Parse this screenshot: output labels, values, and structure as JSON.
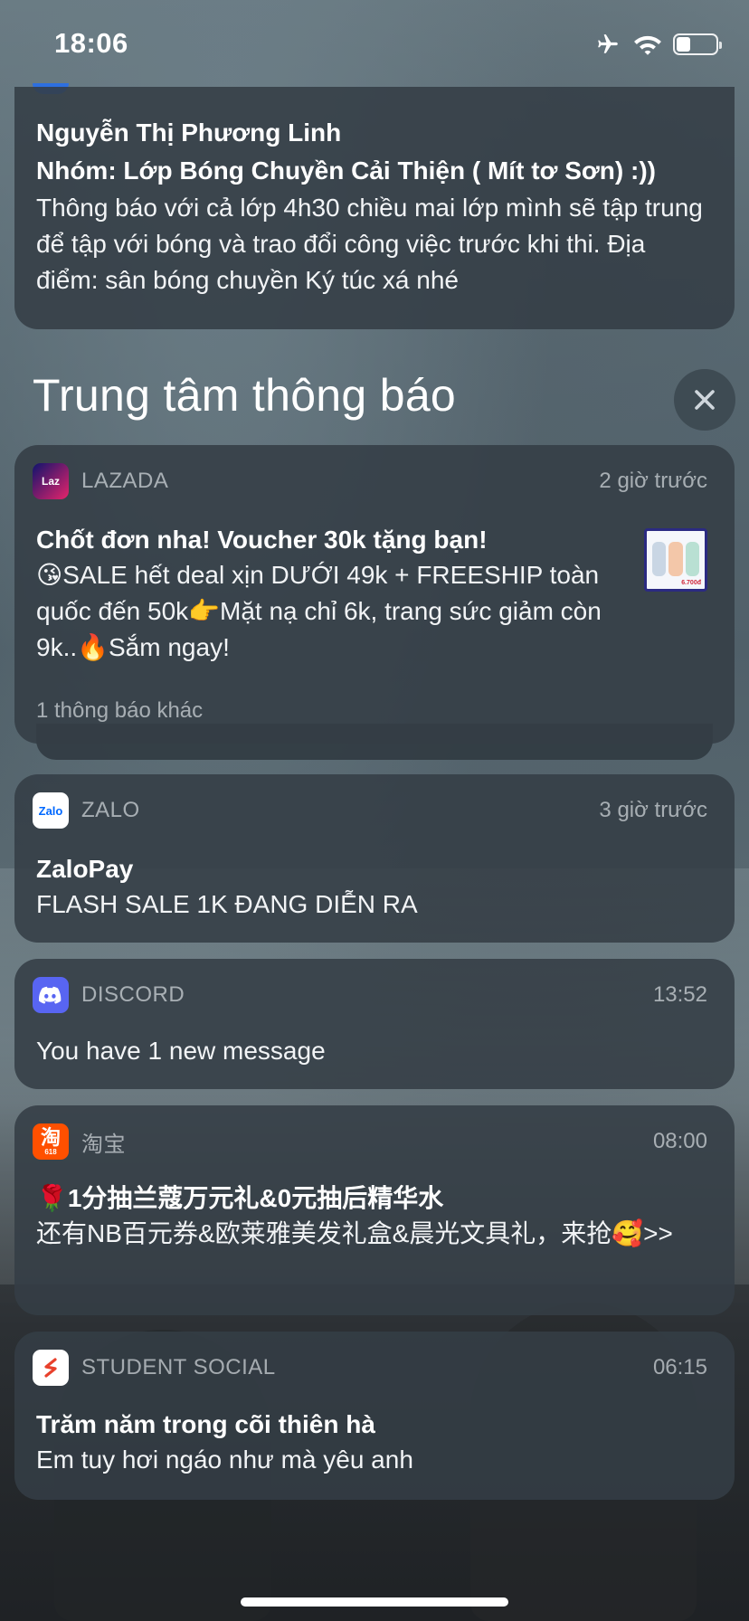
{
  "status_bar": {
    "time": "18:06",
    "icons": [
      "airplane-icon",
      "wifi-icon",
      "battery-icon"
    ],
    "battery_level": 0.35
  },
  "pinned_notification": {
    "sender": "Nguyễn Thị Phương Linh",
    "group": "Nhóm: Lớp Bóng Chuyền Cải Thiện ( Mít tơ Sơn) :))",
    "message": "Thông báo với cả lớp 4h30 chiều mai lớp mình sẽ tập trung để tập với bóng và trao đổi công việc trước khi thi. Địa điểm: sân bóng chuyền Ký túc xá nhé"
  },
  "notification_center": {
    "title": "Trung tâm thông báo"
  },
  "notifications": [
    {
      "app": "LAZADA",
      "icon": "lazada-icon",
      "time": "2 giờ trước",
      "title": "Chốt đơn nha! Voucher 30k tặng bạn!",
      "message": "😘SALE hết deal xịn DƯỚI 49k + FREESHIP toàn quốc đến 50k👉Mặt nạ chỉ 6k, trang sức giảm còn 9k..🔥Sắm ngay!",
      "more": "1 thông báo khác",
      "thumb_price": "6.700đ"
    },
    {
      "app": "ZALO",
      "icon": "zalo-icon",
      "time": "3 giờ trước",
      "title": "ZaloPay",
      "message": "FLASH SALE 1K ĐANG DIỄN RA"
    },
    {
      "app": "DISCORD",
      "icon": "discord-icon",
      "time": "13:52",
      "message": "You have 1 new message"
    },
    {
      "app": "淘宝",
      "icon": "taobao-icon",
      "time": "08:00",
      "title": "🌹1分抽兰蔻万元礼&0元抽后精华水",
      "message": "还有NB百元券&欧莱雅美发礼盒&晨光文具礼，来抢🥰>>"
    },
    {
      "app": "STUDENT SOCIAL",
      "icon": "student-social-icon",
      "time": "06:15",
      "title": "Trăm năm trong cõi thiên hà",
      "message": "Em tuy hơi ngáo như mà yêu anh"
    }
  ],
  "colors": {
    "card_background": "#343e46",
    "lazada_brand": "#1e1ad8",
    "zalo_brand": "#0068ff",
    "discord_brand": "#5865f2",
    "taobao_brand": "#ff5000",
    "student_social_brand": "#e8412c"
  }
}
